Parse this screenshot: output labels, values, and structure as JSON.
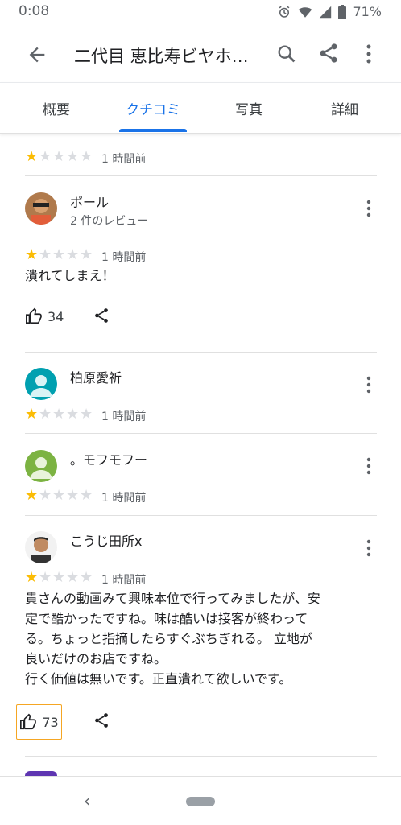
{
  "status": {
    "time": "0:08",
    "battery": "71%"
  },
  "appbar": {
    "title": "二代目 恵比寿ビヤホ…"
  },
  "tabs": [
    "概要",
    "クチコミ",
    "写真",
    "詳細"
  ],
  "reviews": [
    {
      "rating": 1,
      "time": "1 時間前"
    },
    {
      "name": "ポール",
      "sub": "2 件のレビュー",
      "rating": 1,
      "time": "1 時間前",
      "text": "潰れてしまえ！",
      "likes": "34"
    },
    {
      "name": "柏原愛祈",
      "rating": 1,
      "time": "1 時間前"
    },
    {
      "name": "。モフモフー",
      "rating": 1,
      "time": "1 時間前"
    },
    {
      "name": "こうじ田所x",
      "rating": 1,
      "time": "1 時間前",
      "text_lines": [
        "貴さんの動画みて興味本位で行ってみましたが、安",
        "定で酷かったですね。味は酷いは接客が終わって",
        "る。ちょっと指摘したらすぐぶちぎれる。 立地が",
        "良いだけのお店ですね。",
        "行く価値は無いです。正直潰れて欲しいです。"
      ],
      "likes": "73"
    }
  ],
  "colors": {
    "accent": "#1a73e8",
    "star": "#fbbc04",
    "star_off": "#dadce0",
    "focus": "#f5a623"
  }
}
